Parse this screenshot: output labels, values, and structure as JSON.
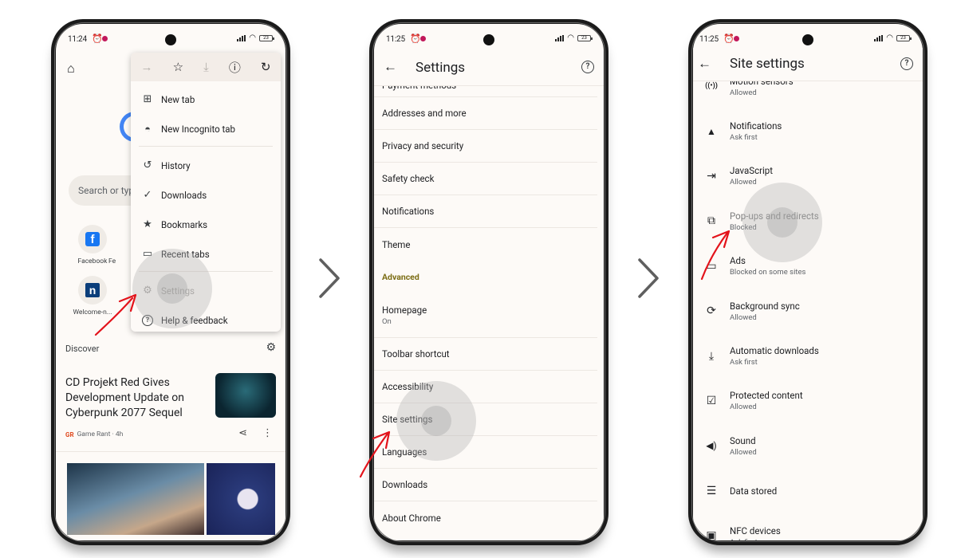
{
  "colors": {
    "screen_bg": "#fdfaf7",
    "section_header": "#7b6c13",
    "annotation_arrow": "#e3131b",
    "google_blue": "#4285f4",
    "status_dot": "#c2185b"
  },
  "phones": [
    {
      "status": {
        "time": "11:24",
        "battery": "23"
      },
      "page": {
        "home_icon": "home-icon",
        "search_placeholder": "Search or type",
        "shortcuts": [
          {
            "label": "Facebook",
            "icon": "facebook-icon",
            "glyph": "f"
          },
          {
            "label": "Fe",
            "icon": "site-icon",
            "glyph": ""
          },
          {
            "label": "Welcome-n...",
            "icon": "n-site-icon",
            "glyph": "n"
          }
        ],
        "discover_label": "Discover",
        "article": {
          "title": "CD Projekt Red Gives Development Update on Cyberpunk 2077 Sequel",
          "source_logo": "GR",
          "source": "Game Rant · 4h"
        }
      },
      "menu": {
        "toolbar": [
          {
            "icon": "forward-icon",
            "glyph": "→",
            "disabled": true
          },
          {
            "icon": "star-icon",
            "glyph": "☆",
            "disabled": false
          },
          {
            "icon": "download-icon",
            "glyph": "⤓",
            "disabled": true
          },
          {
            "icon": "info-icon",
            "glyph": "ⓘ",
            "disabled": false
          },
          {
            "icon": "reload-icon",
            "glyph": "↻",
            "disabled": false
          }
        ],
        "items": [
          {
            "label": "New tab",
            "icon": "new-tab-icon",
            "glyph": "⊞"
          },
          {
            "label": "New Incognito tab",
            "icon": "incognito-icon",
            "glyph": "🕶"
          },
          {
            "label": "History",
            "icon": "history-icon",
            "glyph": "↺"
          },
          {
            "label": "Downloads",
            "icon": "downloads-check-icon",
            "glyph": "✓"
          },
          {
            "label": "Bookmarks",
            "icon": "bookmark-star-icon",
            "glyph": "★"
          },
          {
            "label": "Recent tabs",
            "icon": "recent-tabs-icon",
            "glyph": "▭"
          },
          {
            "label": "Settings",
            "icon": "gear-icon",
            "glyph": "⚙"
          },
          {
            "label": "Help & feedback",
            "icon": "help-icon",
            "glyph": "?"
          }
        ]
      }
    },
    {
      "status": {
        "time": "11:25",
        "battery": "23"
      },
      "title": "Settings",
      "items": [
        {
          "label": "Payment methods",
          "sub": ""
        },
        {
          "label": "Addresses and more",
          "sub": ""
        },
        {
          "label": "Privacy and security",
          "sub": ""
        },
        {
          "label": "Safety check",
          "sub": ""
        },
        {
          "label": "Notifications",
          "sub": ""
        },
        {
          "label": "Theme",
          "sub": ""
        }
      ],
      "section_header": "Advanced",
      "advanced_items": [
        {
          "label": "Homepage",
          "sub": "On"
        },
        {
          "label": "Toolbar shortcut",
          "sub": ""
        },
        {
          "label": "Accessibility",
          "sub": ""
        },
        {
          "label": "Site settings",
          "sub": ""
        },
        {
          "label": "Languages",
          "sub": ""
        },
        {
          "label": "Downloads",
          "sub": ""
        },
        {
          "label": "About Chrome",
          "sub": ""
        }
      ]
    },
    {
      "status": {
        "time": "11:25",
        "battery": "23"
      },
      "title": "Site settings",
      "items": [
        {
          "label": "Motion sensors",
          "sub": "Allowed",
          "icon": "motion-sensors-icon",
          "glyph": "((•))"
        },
        {
          "label": "Notifications",
          "sub": "Ask first",
          "icon": "bell-icon",
          "glyph": "🔔"
        },
        {
          "label": "JavaScript",
          "sub": "Allowed",
          "icon": "javascript-icon",
          "glyph": "⇥"
        },
        {
          "label": "Pop-ups and redirects",
          "sub": "Blocked",
          "icon": "popup-icon",
          "glyph": "↗"
        },
        {
          "label": "Ads",
          "sub": "Blocked on some sites",
          "icon": "ads-icon",
          "glyph": "▭"
        },
        {
          "label": "Background sync",
          "sub": "Allowed",
          "icon": "sync-icon",
          "glyph": "⟳"
        },
        {
          "label": "Automatic downloads",
          "sub": "Ask first",
          "icon": "download-icon",
          "glyph": "⤓"
        },
        {
          "label": "Protected content",
          "sub": "Allowed",
          "icon": "protected-content-icon",
          "glyph": "☑"
        },
        {
          "label": "Sound",
          "sub": "Allowed",
          "icon": "sound-icon",
          "glyph": "🔊"
        },
        {
          "label": "Data stored",
          "sub": "",
          "icon": "data-stored-icon",
          "glyph": "☰"
        },
        {
          "label": "NFC devices",
          "sub": "Ask first",
          "icon": "nfc-icon",
          "glyph": "▣"
        }
      ]
    }
  ],
  "step_arrows": [
    {
      "icon": "chevron-right-icon"
    },
    {
      "icon": "chevron-right-icon"
    }
  ]
}
